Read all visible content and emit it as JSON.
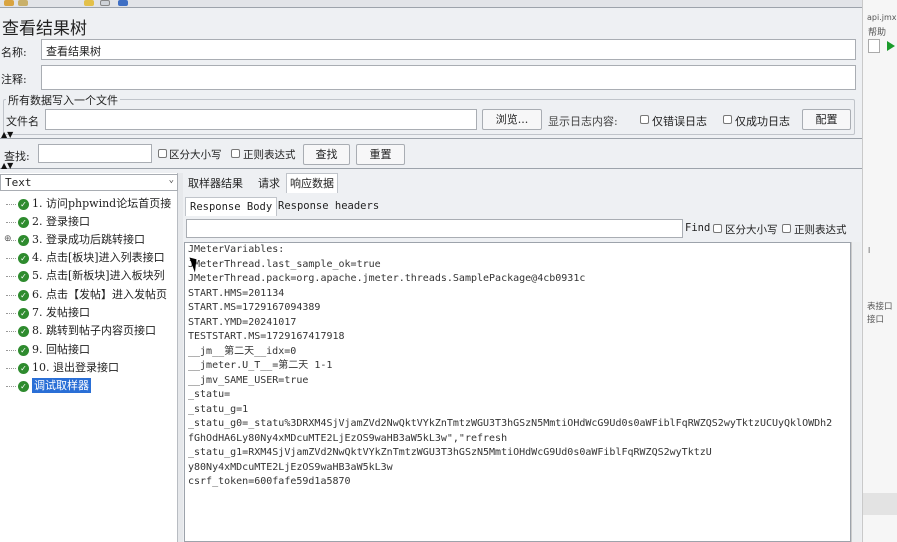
{
  "window": {
    "title": "查看结果树"
  },
  "form": {
    "name_label": "名称:",
    "name_value": "查看结果树",
    "comment_label": "注释:",
    "comment_value": ""
  },
  "file_group": {
    "title": "所有数据写入一个文件",
    "filename_label": "文件名",
    "filename_value": "",
    "browse_button": "浏览...",
    "log_content_label": "显示日志内容:",
    "errors_only_label": "仅错误日志",
    "success_only_label": "仅成功日志",
    "configure_button": "配置"
  },
  "search": {
    "label": "查找:",
    "value": "",
    "case_sensitive_label": "区分大小写",
    "regex_label": "正则表达式",
    "find_button": "查找",
    "reset_button": "重置"
  },
  "renderer": {
    "selected": "Text"
  },
  "tree": {
    "items": [
      {
        "label": "1. 访问phpwind论坛首页接"
      },
      {
        "label": "2. 登录接口"
      },
      {
        "label": "3. 登录成功后跳转接口"
      },
      {
        "label": "4. 点击[板块]进入列表接口"
      },
      {
        "label": "5. 点击[新板块]进入板块列"
      },
      {
        "label": "6. 点击【发帖】进入发帖页"
      },
      {
        "label": "7. 发帖接口"
      },
      {
        "label": "8. 跳转到帖子内容页接口"
      },
      {
        "label": "9. 回帖接口"
      },
      {
        "label": "10. 退出登录接口"
      },
      {
        "label": "调试取样器"
      }
    ]
  },
  "result_tabs": {
    "sampler_result": "取样器结果",
    "request": "请求",
    "response_data": "响应数据"
  },
  "response_tabs": {
    "body": "Response Body",
    "headers": "Response headers"
  },
  "find": {
    "label": "Find",
    "case_sensitive_label": "区分大小写",
    "regex_label": "正则表达式",
    "value": ""
  },
  "response_body": {
    "lines": [
      "JMeterVariables:",
      "JMeterThread.last_sample_ok=true",
      "JMeterThread.pack=org.apache.jmeter.threads.SamplePackage@4cb0931c",
      "START.HMS=201134",
      "START.MS=1729167094389",
      "START.YMD=20241017",
      "TESTSTART.MS=1729167417918",
      "__jm__第二天__idx=0",
      "__jmeter.U_T__=第二天 1-1",
      "__jmv_SAME_USER=true",
      "_statu=",
      "_statu_g=1",
      "_statu_g0=_statu%3DRXM4SjVjamZVd2NwQktVYkZnTmtzWGU3T3hGSzN5MmtiOHdWcG9Ud0s0aWFiblFqRWZQS2wyTktzUCUyQklOWDh2",
      "fGhOdHA6Ly80Ny4xMDcuMTE2LjEzOS9waHB3aW5kL3w\",\"refresh",
      "_statu_g1=RXM4SjVjamZVd2NwQktVYkZnTmtzWGU3T3hGSzN5MmtiOHdWcG9Ud0s0aWFiblFqRWZQS2wyTktzU",
      "y80Ny4xMDcuMTE2LjEzOS9waHB3aW5kL3w",
      "csrf_token=600fafe59d1a5870"
    ]
  },
  "side_window": {
    "title_fragment": "api.jmx) - A",
    "help_menu": "帮助",
    "text_1": "l",
    "text_2": "表接口",
    "text_3": "接口"
  },
  "colors": {
    "selection": "#2a6fd6",
    "success_icon": "#2e8b2e"
  }
}
